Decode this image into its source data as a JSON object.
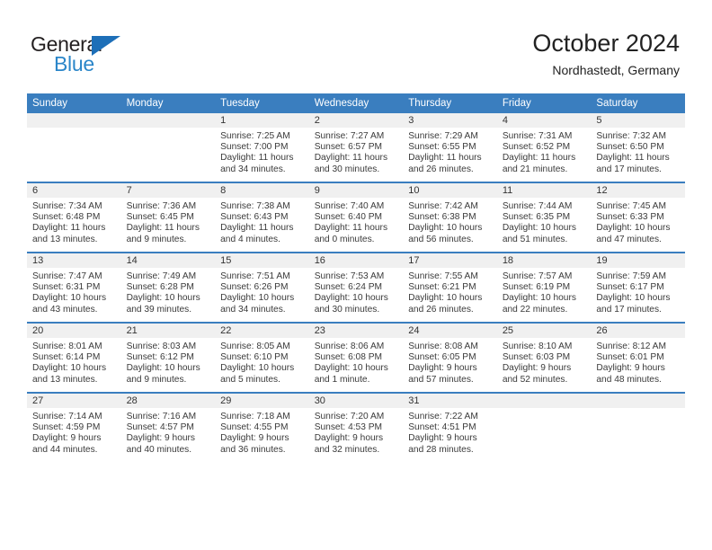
{
  "brand": {
    "name_top": "General",
    "name_bottom": "Blue",
    "accent_color": "#2b86c9",
    "triangle_color": "#1d6fb8"
  },
  "header": {
    "title": "October 2024",
    "subtitle": "Nordhastedt, Germany"
  },
  "calendar": {
    "header_bg": "#3a7ebf",
    "daynum_bg": "#f0f0f0",
    "weekdays": [
      "Sunday",
      "Monday",
      "Tuesday",
      "Wednesday",
      "Thursday",
      "Friday",
      "Saturday"
    ],
    "labels": {
      "sunrise": "Sunrise:",
      "sunset": "Sunset:",
      "daylight": "Daylight:"
    },
    "weeks": [
      [
        {
          "day": "",
          "empty": true
        },
        {
          "day": "",
          "empty": true
        },
        {
          "day": "1",
          "sunrise": "Sunrise: 7:25 AM",
          "sunset": "Sunset: 7:00 PM",
          "daylight": "Daylight: 11 hours and 34 minutes."
        },
        {
          "day": "2",
          "sunrise": "Sunrise: 7:27 AM",
          "sunset": "Sunset: 6:57 PM",
          "daylight": "Daylight: 11 hours and 30 minutes."
        },
        {
          "day": "3",
          "sunrise": "Sunrise: 7:29 AM",
          "sunset": "Sunset: 6:55 PM",
          "daylight": "Daylight: 11 hours and 26 minutes."
        },
        {
          "day": "4",
          "sunrise": "Sunrise: 7:31 AM",
          "sunset": "Sunset: 6:52 PM",
          "daylight": "Daylight: 11 hours and 21 minutes."
        },
        {
          "day": "5",
          "sunrise": "Sunrise: 7:32 AM",
          "sunset": "Sunset: 6:50 PM",
          "daylight": "Daylight: 11 hours and 17 minutes."
        }
      ],
      [
        {
          "day": "6",
          "sunrise": "Sunrise: 7:34 AM",
          "sunset": "Sunset: 6:48 PM",
          "daylight": "Daylight: 11 hours and 13 minutes."
        },
        {
          "day": "7",
          "sunrise": "Sunrise: 7:36 AM",
          "sunset": "Sunset: 6:45 PM",
          "daylight": "Daylight: 11 hours and 9 minutes."
        },
        {
          "day": "8",
          "sunrise": "Sunrise: 7:38 AM",
          "sunset": "Sunset: 6:43 PM",
          "daylight": "Daylight: 11 hours and 4 minutes."
        },
        {
          "day": "9",
          "sunrise": "Sunrise: 7:40 AM",
          "sunset": "Sunset: 6:40 PM",
          "daylight": "Daylight: 11 hours and 0 minutes."
        },
        {
          "day": "10",
          "sunrise": "Sunrise: 7:42 AM",
          "sunset": "Sunset: 6:38 PM",
          "daylight": "Daylight: 10 hours and 56 minutes."
        },
        {
          "day": "11",
          "sunrise": "Sunrise: 7:44 AM",
          "sunset": "Sunset: 6:35 PM",
          "daylight": "Daylight: 10 hours and 51 minutes."
        },
        {
          "day": "12",
          "sunrise": "Sunrise: 7:45 AM",
          "sunset": "Sunset: 6:33 PM",
          "daylight": "Daylight: 10 hours and 47 minutes."
        }
      ],
      [
        {
          "day": "13",
          "sunrise": "Sunrise: 7:47 AM",
          "sunset": "Sunset: 6:31 PM",
          "daylight": "Daylight: 10 hours and 43 minutes."
        },
        {
          "day": "14",
          "sunrise": "Sunrise: 7:49 AM",
          "sunset": "Sunset: 6:28 PM",
          "daylight": "Daylight: 10 hours and 39 minutes."
        },
        {
          "day": "15",
          "sunrise": "Sunrise: 7:51 AM",
          "sunset": "Sunset: 6:26 PM",
          "daylight": "Daylight: 10 hours and 34 minutes."
        },
        {
          "day": "16",
          "sunrise": "Sunrise: 7:53 AM",
          "sunset": "Sunset: 6:24 PM",
          "daylight": "Daylight: 10 hours and 30 minutes."
        },
        {
          "day": "17",
          "sunrise": "Sunrise: 7:55 AM",
          "sunset": "Sunset: 6:21 PM",
          "daylight": "Daylight: 10 hours and 26 minutes."
        },
        {
          "day": "18",
          "sunrise": "Sunrise: 7:57 AM",
          "sunset": "Sunset: 6:19 PM",
          "daylight": "Daylight: 10 hours and 22 minutes."
        },
        {
          "day": "19",
          "sunrise": "Sunrise: 7:59 AM",
          "sunset": "Sunset: 6:17 PM",
          "daylight": "Daylight: 10 hours and 17 minutes."
        }
      ],
      [
        {
          "day": "20",
          "sunrise": "Sunrise: 8:01 AM",
          "sunset": "Sunset: 6:14 PM",
          "daylight": "Daylight: 10 hours and 13 minutes."
        },
        {
          "day": "21",
          "sunrise": "Sunrise: 8:03 AM",
          "sunset": "Sunset: 6:12 PM",
          "daylight": "Daylight: 10 hours and 9 minutes."
        },
        {
          "day": "22",
          "sunrise": "Sunrise: 8:05 AM",
          "sunset": "Sunset: 6:10 PM",
          "daylight": "Daylight: 10 hours and 5 minutes."
        },
        {
          "day": "23",
          "sunrise": "Sunrise: 8:06 AM",
          "sunset": "Sunset: 6:08 PM",
          "daylight": "Daylight: 10 hours and 1 minute."
        },
        {
          "day": "24",
          "sunrise": "Sunrise: 8:08 AM",
          "sunset": "Sunset: 6:05 PM",
          "daylight": "Daylight: 9 hours and 57 minutes."
        },
        {
          "day": "25",
          "sunrise": "Sunrise: 8:10 AM",
          "sunset": "Sunset: 6:03 PM",
          "daylight": "Daylight: 9 hours and 52 minutes."
        },
        {
          "day": "26",
          "sunrise": "Sunrise: 8:12 AM",
          "sunset": "Sunset: 6:01 PM",
          "daylight": "Daylight: 9 hours and 48 minutes."
        }
      ],
      [
        {
          "day": "27",
          "sunrise": "Sunrise: 7:14 AM",
          "sunset": "Sunset: 4:59 PM",
          "daylight": "Daylight: 9 hours and 44 minutes."
        },
        {
          "day": "28",
          "sunrise": "Sunrise: 7:16 AM",
          "sunset": "Sunset: 4:57 PM",
          "daylight": "Daylight: 9 hours and 40 minutes."
        },
        {
          "day": "29",
          "sunrise": "Sunrise: 7:18 AM",
          "sunset": "Sunset: 4:55 PM",
          "daylight": "Daylight: 9 hours and 36 minutes."
        },
        {
          "day": "30",
          "sunrise": "Sunrise: 7:20 AM",
          "sunset": "Sunset: 4:53 PM",
          "daylight": "Daylight: 9 hours and 32 minutes."
        },
        {
          "day": "31",
          "sunrise": "Sunrise: 7:22 AM",
          "sunset": "Sunset: 4:51 PM",
          "daylight": "Daylight: 9 hours and 28 minutes."
        },
        {
          "day": "",
          "empty": true
        },
        {
          "day": "",
          "empty": true
        }
      ]
    ]
  }
}
